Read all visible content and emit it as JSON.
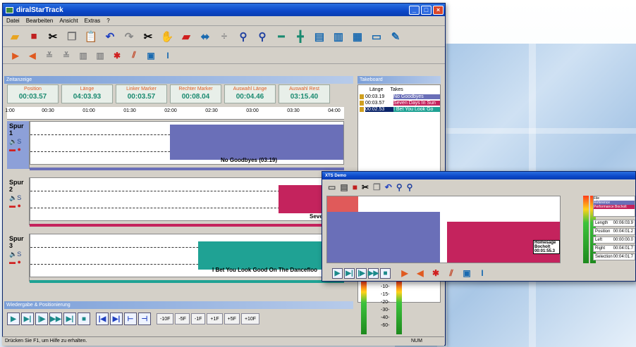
{
  "app": {
    "title": "diralStarTrack",
    "menu": [
      "Datei",
      "Bearbeiten",
      "Ansicht",
      "Extras",
      "?"
    ]
  },
  "icons": {
    "toolbar1": [
      "open-folder-icon",
      "save-icon",
      "cut-icon",
      "copy-icon",
      "paste-icon",
      "undo-icon",
      "redo-icon",
      "split-icon",
      "hand-icon",
      "eraser-icon",
      "align-icon",
      "divide-icon",
      "zoom-in-icon",
      "zoom-out-icon",
      "collapse-icon",
      "expand-icon",
      "view1-icon",
      "view2-icon",
      "view3-icon",
      "view4-icon",
      "edit-icon"
    ],
    "toolbar2": [
      "play-right-icon",
      "play-left-icon",
      "marker1-icon",
      "marker2-icon",
      "marker3-icon",
      "marker4-icon",
      "cross-icon",
      "fade-icon",
      "monitor-icon",
      "cursor-icon"
    ]
  },
  "panels": {
    "zeitanzeige": "Zeitanzeige",
    "takeboard": "Takeboard",
    "transport": "Wiedergabe & Positionierung"
  },
  "info": [
    {
      "label": "Position",
      "value": "00:03.57"
    },
    {
      "label": "Länge",
      "value": "04:03.93"
    },
    {
      "label": "Linker Marker",
      "value": "00:03.57"
    },
    {
      "label": "Rechter Marker",
      "value": "00:08.04"
    },
    {
      "label": "Auswahl Länge",
      "value": "00:04.46"
    },
    {
      "label": "Auswahl Rest",
      "value": "03:15.40"
    }
  ],
  "ruler": [
    "1:00",
    "00:30",
    "01:00",
    "01:30",
    "02:00",
    "02:30",
    "03:00",
    "03:30",
    "04:00"
  ],
  "tracks": [
    {
      "name": "Spur 1",
      "clip": "No Goodbyes (03:19)"
    },
    {
      "name": "Spur 2",
      "clip": "Seve"
    },
    {
      "name": "Spur 3",
      "clip": "I Bet You Look Good On The Dancefloo"
    }
  ],
  "takeboard": {
    "col_len": "Länge",
    "col_takes": "Takes",
    "takes": [
      {
        "time": "00:03.19",
        "name": "No Goodbyes"
      },
      {
        "time": "00:03.57",
        "name": "Seven Days In Sun"
      },
      {
        "time": "00:02.53",
        "name": "I Bet You Look Go"
      }
    ]
  },
  "meter_scale": [
    "-10-",
    "-15-",
    "-20-",
    "-30-",
    "-40-",
    "-60-"
  ],
  "transport_steps": [
    "-10F",
    "-5F",
    "-1F",
    "+1F",
    "+5F",
    "+10F"
  ],
  "status": {
    "text": "Drücken Sie F1, um Hilfe zu erhalten.",
    "num": "NUM"
  },
  "overlay": {
    "title": "XTS Demo",
    "clip_label": "Homesage Bocholt",
    "clip_time": "00:01:55.3",
    "info_rows": [
      {
        "label": "Length",
        "value": "00:06:03.9"
      },
      {
        "label": "Position",
        "value": "00:04:01.2"
      },
      {
        "label": "Left",
        "value": "00:00:00.0"
      },
      {
        "label": "Right",
        "value": "00:04:01.7"
      },
      {
        "label": "Selection",
        "value": "00:04:01.7"
      }
    ],
    "list": [
      "File",
      "Reference",
      "Performance Bocholt"
    ]
  },
  "colors": {
    "track1": "#6a6fb8",
    "track2": "#c4235d",
    "track3": "#1fa294",
    "accent": "#1a8a70",
    "label": "#e05a20"
  }
}
